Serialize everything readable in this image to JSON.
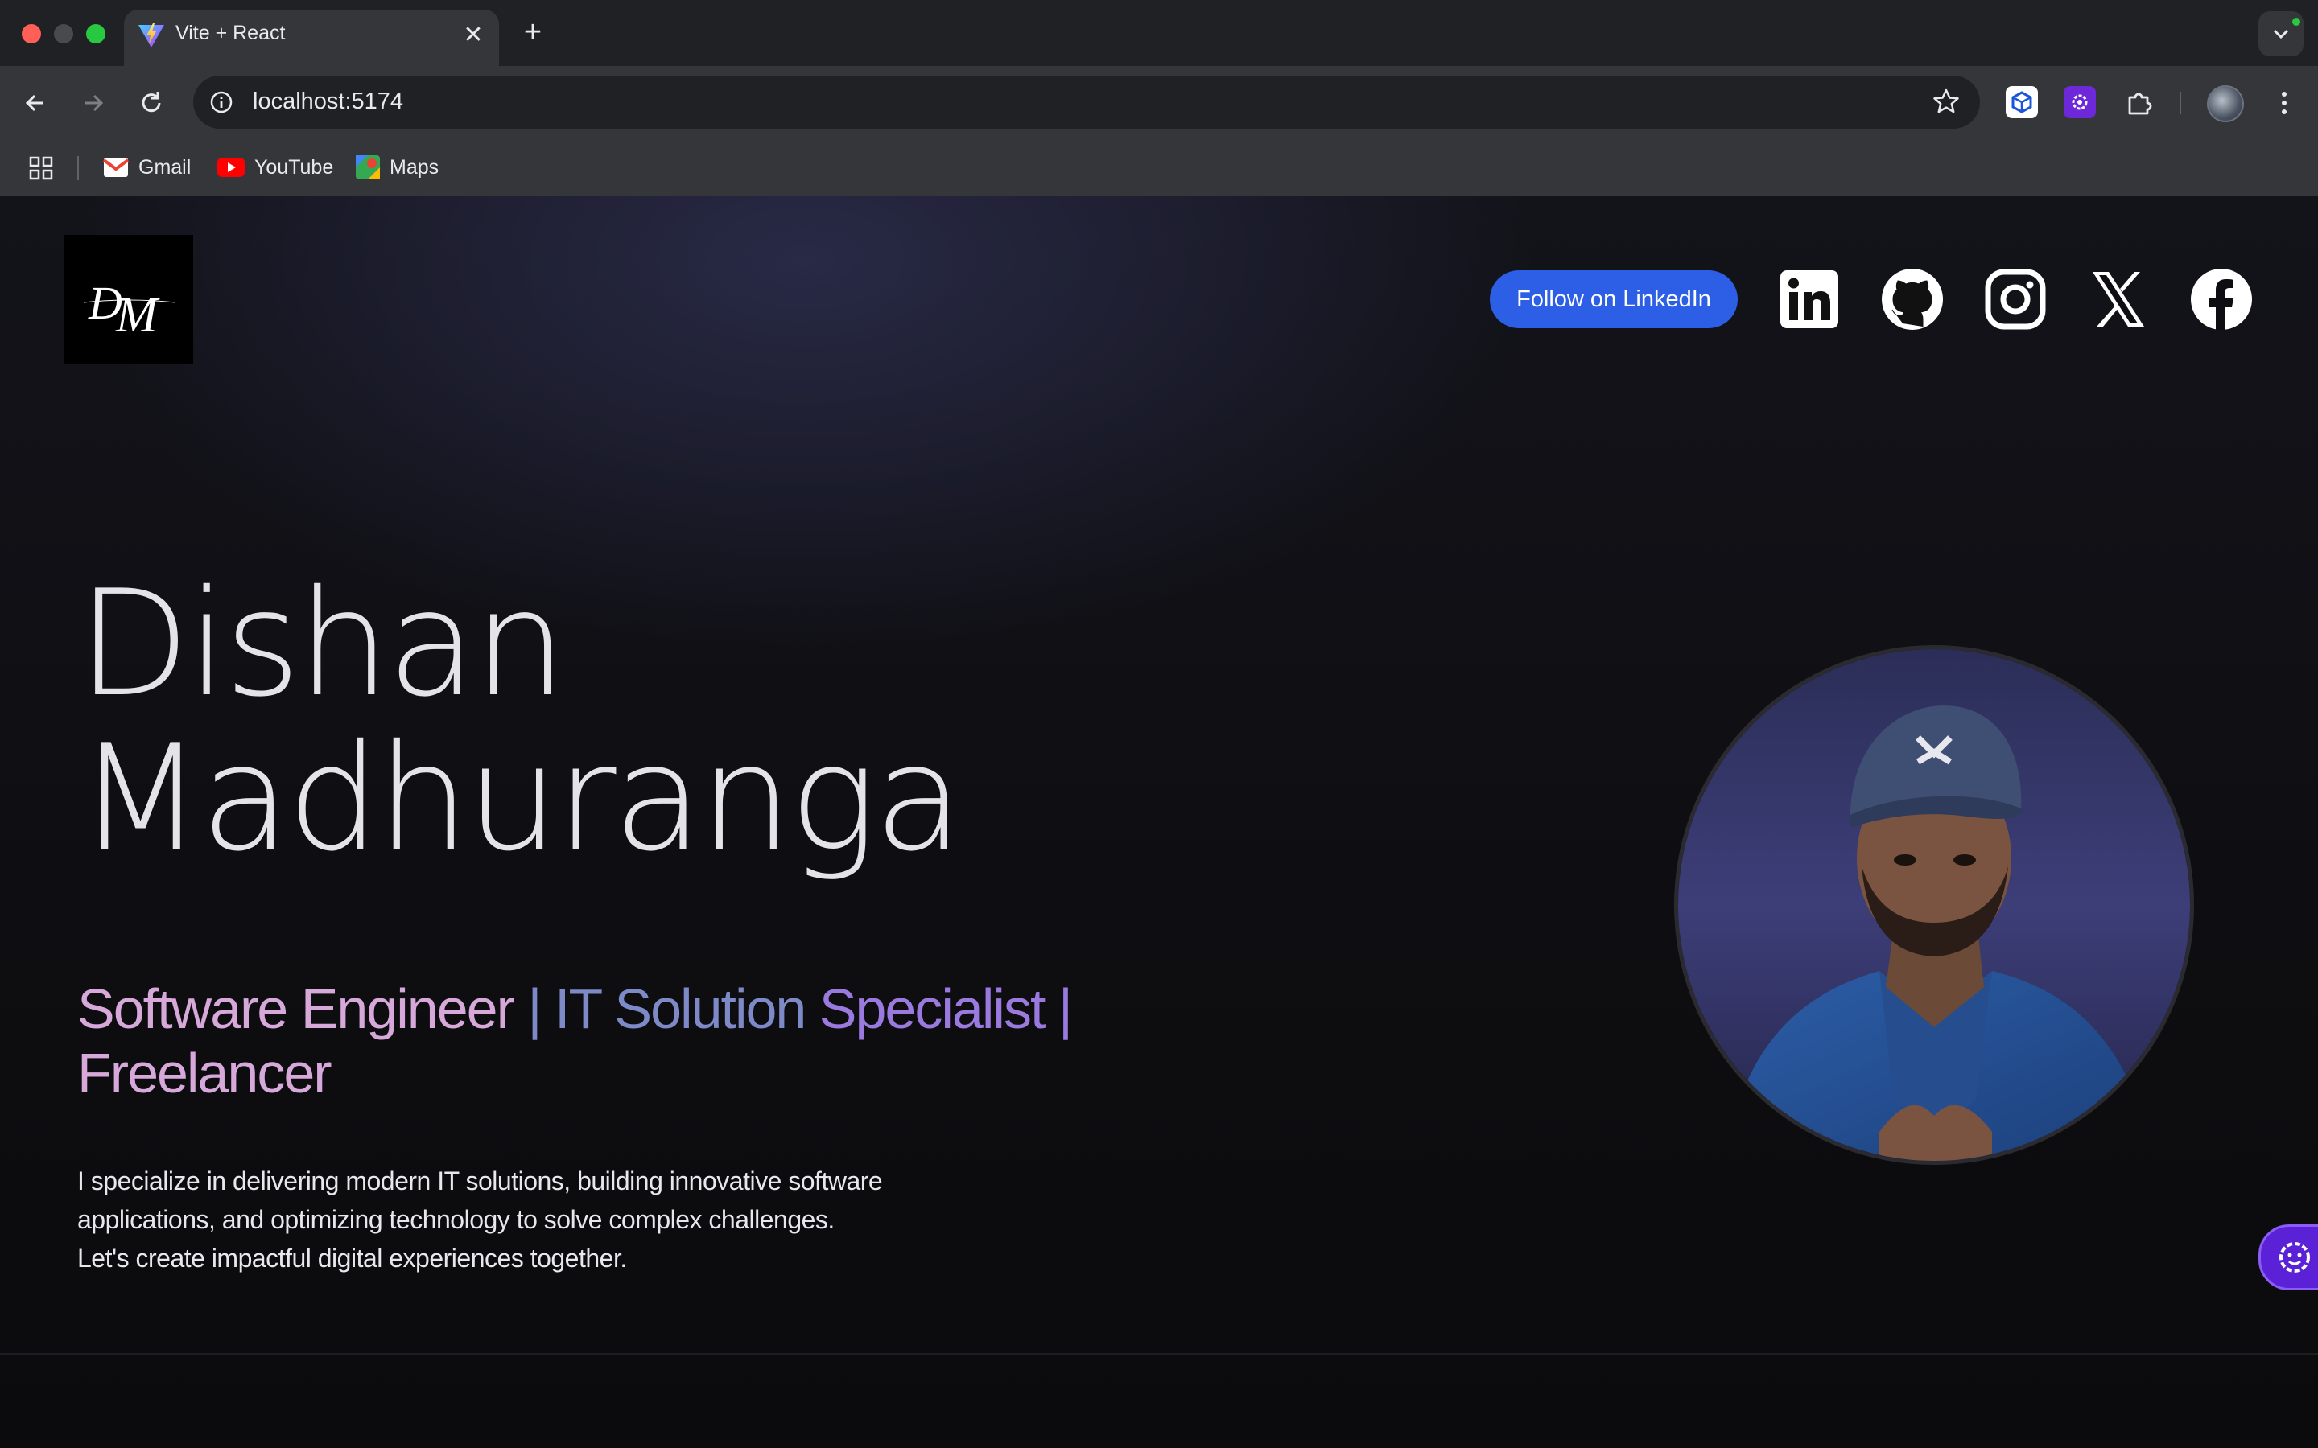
{
  "browser": {
    "tab_title": "Vite + React",
    "url": "localhost:5174",
    "bookmarks": [
      "Gmail",
      "YouTube",
      "Maps"
    ]
  },
  "header": {
    "follow_button": "Follow on LinkedIn",
    "social_icons": [
      "linkedin-icon",
      "github-icon",
      "instagram-icon",
      "x-icon",
      "facebook-icon"
    ]
  },
  "hero": {
    "name_line1": "Dishan",
    "name_line2": "Madhuranga",
    "tagline": {
      "part1": "Software Engineer",
      "sep1": " | ",
      "part2": "IT Solution",
      "part3": " Specialist |",
      "part4": "Freelancer"
    },
    "intro": [
      "I specialize in delivering modern IT solutions, building innovative software",
      "applications, and optimizing technology to solve complex challenges.",
      "Let's create impactful digital experiences together."
    ]
  },
  "colors": {
    "accent_button": "#2c5fe6",
    "tagline_pink": "#d7a8da",
    "tagline_blue": "#7d8ac7",
    "tagline_purple": "#9b7ae0",
    "widget": "#5b21d6"
  }
}
